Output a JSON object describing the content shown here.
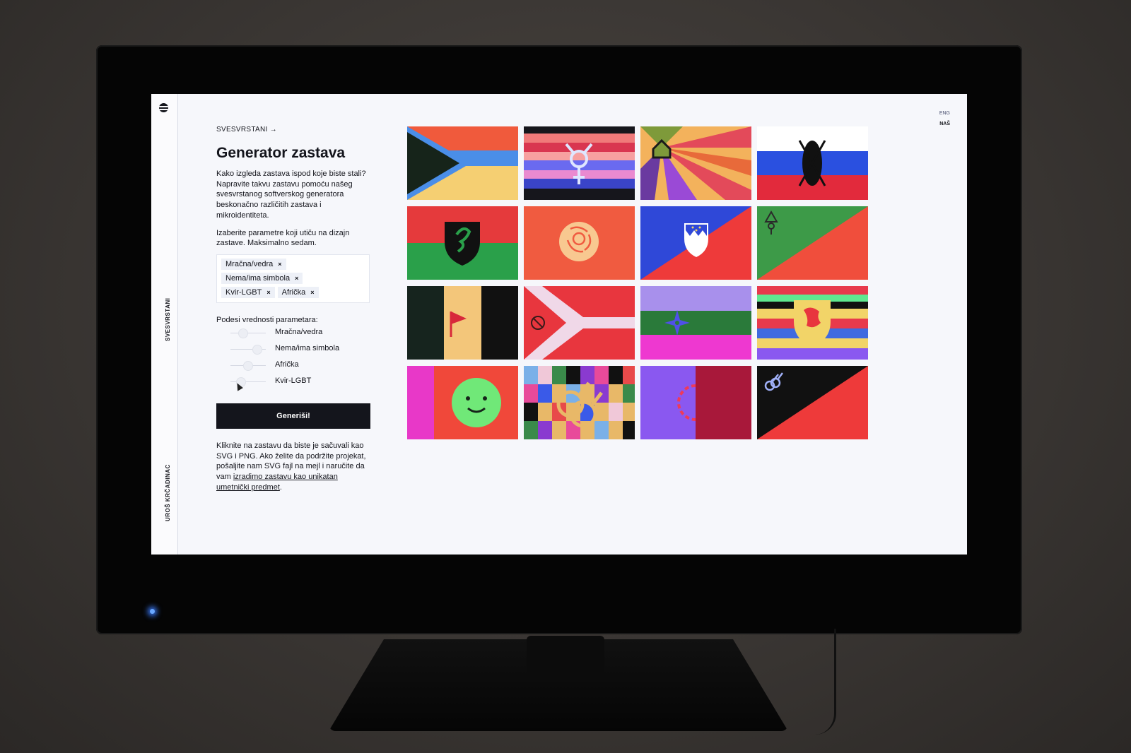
{
  "sidebar": {
    "brand_vertical": "SVESVRSTANI",
    "author_vertical": "UROŠ KRČADINAC"
  },
  "lang": {
    "eng": "ENG",
    "nas": "NAŠ"
  },
  "header": {
    "breadcrumb": "SVESVRSTANI →"
  },
  "main": {
    "title": "Generator zastava",
    "intro": "Kako izgleda zastava ispod koje biste stali? Napravite takvu zastavu pomoću našeg svesvrstanog softverskog generatora beskonačno različitih zastava i mikroidentiteta.",
    "params_intro": "Izaberite parametre koji utiču na dizajn zastave. Maksimalno sedam.",
    "tags": [
      "Mračna/vedra",
      "Nema/ima simbola",
      "Kvir-LGBT",
      "Afrička"
    ],
    "tag_remove": "×",
    "values_label": "Podesi vrednosti parametara:",
    "sliders": [
      {
        "label": "Mračna/vedra",
        "value": 0.35
      },
      {
        "label": "Nema/ima simbola",
        "value": 0.75
      },
      {
        "label": "Afrička",
        "value": 0.5
      },
      {
        "label": "Kvir-LGBT",
        "value": 0.3
      }
    ],
    "generate_button": "Generiši!",
    "note_text": "Kliknite na zastavu da biste je sačuvali kao SVG i PNG. Ako želite da podržite projekat, pošaljite nam SVG fajl na mejl i naručite da vam ",
    "note_link": "izradimo zastavu kao unikatan umetnički predmet",
    "note_end": "."
  },
  "flags": [
    {
      "name": "flag-chevron-blue-yellow",
      "colors": [
        "#f05a3c",
        "#4a8ee8",
        "#f5cf72",
        "#16241a"
      ]
    },
    {
      "name": "flag-transgender-stripes",
      "colors": [
        "#16161c",
        "#f07a7a",
        "#d93650",
        "#6a6af0",
        "#ea8ad0"
      ]
    },
    {
      "name": "flag-house-rays",
      "colors": [
        "#f3b25c",
        "#e34a5a",
        "#9a4ad6",
        "#7e9a3a"
      ]
    },
    {
      "name": "flag-shield-tricolor",
      "colors": [
        "#ffffff",
        "#2a50e0",
        "#e22a3c",
        "#111111"
      ]
    },
    {
      "name": "flag-dragon-shield",
      "colors": [
        "#e53a3c",
        "#2aa04a",
        "#111111",
        "#e53a3c"
      ]
    },
    {
      "name": "flag-rose",
      "colors": [
        "#f05b40",
        "#f8c890"
      ]
    },
    {
      "name": "flag-slovenia-diagonal",
      "colors": [
        "#2f48d8",
        "#ee3a3a",
        "#ffffff"
      ]
    },
    {
      "name": "flag-green-red-diagonal",
      "colors": [
        "#3d9a48",
        "#f04e3c",
        "#2a2a2a"
      ]
    },
    {
      "name": "flag-triband-pennant",
      "colors": [
        "#16241e",
        "#f3c67a",
        "#111111",
        "#d8283a"
      ]
    },
    {
      "name": "flag-y-chevron",
      "colors": [
        "#e8363e",
        "#f0d8e8",
        "#e8363e"
      ]
    },
    {
      "name": "flag-star-bands",
      "colors": [
        "#a890ec",
        "#2a7a3a",
        "#ee38d0",
        "#5050e8"
      ]
    },
    {
      "name": "flag-lion-shield",
      "colors": [
        "#e83a4c",
        "#f2d468",
        "#3f6ae0",
        "#111111",
        "#60e890"
      ]
    },
    {
      "name": "flag-smiley",
      "colors": [
        "#f0483a",
        "#e838c8",
        "#70e878",
        "#16241a"
      ]
    },
    {
      "name": "flag-male-symbol-checker",
      "colors": [
        "#e8b868",
        "#7ab0e8",
        "#e84a9a",
        "#3a8a4a",
        "#8a3ad0"
      ]
    },
    {
      "name": "flag-purple-maroon",
      "colors": [
        "#8a58f0",
        "#a8183a",
        "#ee3a5a"
      ]
    },
    {
      "name": "flag-black-red-diagonal",
      "colors": [
        "#111111",
        "#ee3a3a",
        "#a0b0f8"
      ]
    }
  ]
}
